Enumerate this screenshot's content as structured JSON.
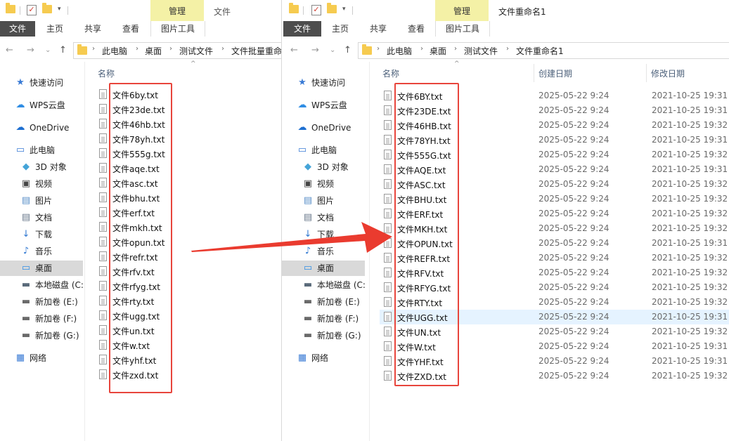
{
  "left": {
    "manage_tab": "管理",
    "title": "文件",
    "ribbon": {
      "file": "文件",
      "home": "主页",
      "share": "共享",
      "view": "查看",
      "picture_tools": "图片工具"
    },
    "breadcrumbs": [
      "此电脑",
      "桌面",
      "测试文件",
      "文件批量重命"
    ],
    "column_name": "名称",
    "files": [
      "文件6by.txt",
      "文件23de.txt",
      "文件46hb.txt",
      "文件78yh.txt",
      "文件555g.txt",
      "文件aqe.txt",
      "文件asc.txt",
      "文件bhu.txt",
      "文件erf.txt",
      "文件mkh.txt",
      "文件opun.txt",
      "文件refr.txt",
      "文件rfv.txt",
      "文件rfyg.txt",
      "文件rty.txt",
      "文件ugg.txt",
      "文件un.txt",
      "文件w.txt",
      "文件yhf.txt",
      "文件zxd.txt"
    ]
  },
  "right": {
    "manage_tab": "管理",
    "title": "文件重命名1",
    "ribbon": {
      "file": "文件",
      "home": "主页",
      "share": "共享",
      "view": "查看",
      "picture_tools": "图片工具"
    },
    "breadcrumbs": [
      "此电脑",
      "桌面",
      "测试文件",
      "文件重命名1"
    ],
    "columns": {
      "name": "名称",
      "created": "创建日期",
      "modified": "修改日期"
    },
    "files": [
      {
        "name": "文件6BY.txt",
        "created": "2025-05-22 9:24",
        "modified": "2021-10-25 19:31"
      },
      {
        "name": "文件23DE.txt",
        "created": "2025-05-22 9:24",
        "modified": "2021-10-25 19:31"
      },
      {
        "name": "文件46HB.txt",
        "created": "2025-05-22 9:24",
        "modified": "2021-10-25 19:32"
      },
      {
        "name": "文件78YH.txt",
        "created": "2025-05-22 9:24",
        "modified": "2021-10-25 19:31"
      },
      {
        "name": "文件555G.txt",
        "created": "2025-05-22 9:24",
        "modified": "2021-10-25 19:32"
      },
      {
        "name": "文件AQE.txt",
        "created": "2025-05-22 9:24",
        "modified": "2021-10-25 19:31"
      },
      {
        "name": "文件ASC.txt",
        "created": "2025-05-22 9:24",
        "modified": "2021-10-25 19:32"
      },
      {
        "name": "文件BHU.txt",
        "created": "2025-05-22 9:24",
        "modified": "2021-10-25 19:32"
      },
      {
        "name": "文件ERF.txt",
        "created": "2025-05-22 9:24",
        "modified": "2021-10-25 19:32"
      },
      {
        "name": "文件MKH.txt",
        "created": "2025-05-22 9:24",
        "modified": "2021-10-25 19:32"
      },
      {
        "name": "文件OPUN.txt",
        "created": "2025-05-22 9:24",
        "modified": "2021-10-25 19:31"
      },
      {
        "name": "文件REFR.txt",
        "created": "2025-05-22 9:24",
        "modified": "2021-10-25 19:32"
      },
      {
        "name": "文件RFV.txt",
        "created": "2025-05-22 9:24",
        "modified": "2021-10-25 19:32"
      },
      {
        "name": "文件RFYG.txt",
        "created": "2025-05-22 9:24",
        "modified": "2021-10-25 19:32"
      },
      {
        "name": "文件RTY.txt",
        "created": "2025-05-22 9:24",
        "modified": "2021-10-25 19:32"
      },
      {
        "name": "文件UGG.txt",
        "created": "2025-05-22 9:24",
        "modified": "2021-10-25 19:31"
      },
      {
        "name": "文件UN.txt",
        "created": "2025-05-22 9:24",
        "modified": "2021-10-25 19:32"
      },
      {
        "name": "文件W.txt",
        "created": "2025-05-22 9:24",
        "modified": "2021-10-25 19:31"
      },
      {
        "name": "文件YHF.txt",
        "created": "2025-05-22 9:24",
        "modified": "2021-10-25 19:31"
      },
      {
        "name": "文件ZXD.txt",
        "created": "2025-05-22 9:24",
        "modified": "2021-10-25 19:32"
      }
    ]
  },
  "nav": [
    {
      "label": "快速访问",
      "icon": "star-icon"
    },
    {
      "label": "WPS云盘",
      "icon": "cloud-icon"
    },
    {
      "label": "OneDrive",
      "icon": "onedrive-icon"
    },
    {
      "label": "此电脑",
      "icon": "computer-icon"
    },
    {
      "label": "3D 对象",
      "icon": "cube-icon"
    },
    {
      "label": "视频",
      "icon": "video-icon"
    },
    {
      "label": "图片",
      "icon": "picture-icon"
    },
    {
      "label": "文档",
      "icon": "document-icon"
    },
    {
      "label": "下载",
      "icon": "download-icon"
    },
    {
      "label": "音乐",
      "icon": "music-icon"
    },
    {
      "label": "桌面",
      "icon": "desktop-icon"
    },
    {
      "label": "本地磁盘 (C:",
      "icon": "drive-c-icon"
    },
    {
      "label": "新加卷 (E:)",
      "icon": "drive-icon"
    },
    {
      "label": "新加卷 (F:)",
      "icon": "drive-icon"
    },
    {
      "label": "新加卷 (G:)",
      "icon": "drive-icon"
    },
    {
      "label": "网络",
      "icon": "network-icon"
    }
  ],
  "colors": {
    "accent_red": "#e8453c",
    "manage_tab": "#f4f1a6",
    "file_tab": "#4d4d4d",
    "selected_nav": "#d9d9d9",
    "highlight_row": "#e5f3ff"
  }
}
